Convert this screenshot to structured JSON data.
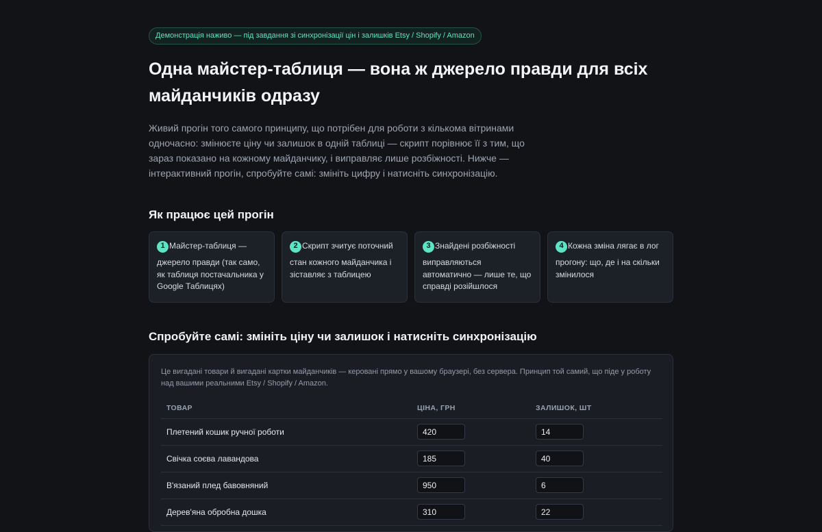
{
  "badge": "Демонстрація наживо — під завдання зі синхронізації цін і залишків Etsy / Shopify / Amazon",
  "hero": {
    "title": "Одна майстер-таблиця — вона ж джерело правди для всіх майданчиків одразу",
    "lead": "Живий прогін того самого принципу, що потрібен для роботи з кількома вітринами одночасно: змінюєте ціну чи залишок в одній таблиці — скрипт порівнює її з тим, що зараз показано на кожному майданчику, і виправляє лише розбіжності. Нижче — інтерактивний прогін, спробуйте самі: змініть цифру і натисніть синхронізацію."
  },
  "how": {
    "title": "Як працює цей прогін",
    "steps": [
      {
        "num": "1",
        "first": "Майстер-таблиця —",
        "rest": "джерело правди (так само, як таблиця постачальника у Google Таблицях)"
      },
      {
        "num": "2",
        "first": "Скрипт зчитує поточний",
        "rest": "стан кожного майданчика і зіставляє з таблицею"
      },
      {
        "num": "3",
        "first": "Знайдені розбіжності",
        "rest": "виправляються автоматично — лише те, що справді розійшлося"
      },
      {
        "num": "4",
        "first": "Кожна зміна лягає в лог",
        "rest": "прогону: що, де і на скільки змінилося"
      }
    ]
  },
  "demo": {
    "title": "Спробуйте самі: змініть ціну чи залишок і натисніть синхронізацію",
    "note": "Це вигадані товари й вигадані картки майданчиків — керовані прямо у вашому браузері, без сервера. Принцип той самий, що піде у роботу над вашими реальними Etsy / Shopify / Amazon.",
    "columns": {
      "product": "ТОВАР",
      "price": "ЦІНА, ГРН",
      "stock": "ЗАЛИШОК, ШТ"
    },
    "rows": [
      {
        "name": "Плетений кошик ручної роботи",
        "price": "420",
        "stock": "14"
      },
      {
        "name": "Свічка соєва лавандова",
        "price": "185",
        "stock": "40"
      },
      {
        "name": "В'язаний плед бавовняний",
        "price": "950",
        "stock": "6"
      },
      {
        "name": "Дерев'яна обробна дошка",
        "price": "310",
        "stock": "22"
      }
    ]
  },
  "colors": {
    "accent": "#5fe3c5",
    "background": "#111317",
    "card": "#1c2027"
  }
}
